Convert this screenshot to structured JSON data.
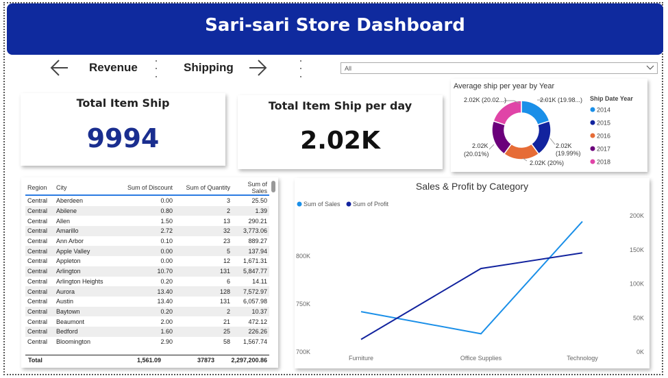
{
  "header": {
    "title": "Sari-sari Store Dashboard"
  },
  "nav": {
    "revenue_label": "Revenue",
    "shipping_label": "Shipping",
    "back_icon": "arrow-left-icon",
    "forward_icon": "arrow-right-icon"
  },
  "filter": {
    "value": "All"
  },
  "kpi_total": {
    "title": "Total Item Ship",
    "value": "9994",
    "color": "#1a2e8f"
  },
  "kpi_per_day": {
    "title": "Total Item Ship per day",
    "value": "2.02K"
  },
  "donut": {
    "title": "Average ship per year by Year",
    "legend_title": "Ship Date Year",
    "labels": [
      "2.01K (19.98...)",
      "2.02K",
      "(19.99%)",
      "2.02K (20%)",
      "2.02K",
      "(20.01%)",
      "2.02K (20.02...)"
    ],
    "chart_data": {
      "type": "pie",
      "categories": [
        "2014",
        "2015",
        "2016",
        "2017",
        "2018"
      ],
      "values": [
        19.98,
        19.99,
        20.0,
        20.01,
        20.02
      ],
      "colors": [
        "#1a8fe8",
        "#12239e",
        "#e66c37",
        "#6b007b",
        "#e044a7"
      ]
    }
  },
  "table": {
    "headers": [
      "Region",
      "City",
      "Sum of Discount",
      "Sum of Quantity",
      "Sum of Sales"
    ],
    "rows": [
      [
        "Central",
        "Aberdeen",
        "0.00",
        "3",
        "25.50"
      ],
      [
        "Central",
        "Abilene",
        "0.80",
        "2",
        "1.39"
      ],
      [
        "Central",
        "Allen",
        "1.50",
        "13",
        "290.21"
      ],
      [
        "Central",
        "Amarillo",
        "2.72",
        "32",
        "3,773.06"
      ],
      [
        "Central",
        "Ann Arbor",
        "0.10",
        "23",
        "889.27"
      ],
      [
        "Central",
        "Apple Valley",
        "0.00",
        "5",
        "137.94"
      ],
      [
        "Central",
        "Appleton",
        "0.00",
        "12",
        "1,671.31"
      ],
      [
        "Central",
        "Arlington",
        "10.70",
        "131",
        "5,847.77"
      ],
      [
        "Central",
        "Arlington Heights",
        "0.20",
        "6",
        "14.11"
      ],
      [
        "Central",
        "Aurora",
        "13.40",
        "128",
        "7,572.97"
      ],
      [
        "Central",
        "Austin",
        "13.40",
        "131",
        "6,057.98"
      ],
      [
        "Central",
        "Baytown",
        "0.20",
        "2",
        "10.37"
      ],
      [
        "Central",
        "Beaumont",
        "2.00",
        "21",
        "472.12"
      ],
      [
        "Central",
        "Bedford",
        "1.60",
        "25",
        "226.26"
      ],
      [
        "Central",
        "Bloomington",
        "2.90",
        "58",
        "1,567.74"
      ]
    ],
    "total": {
      "label": "Total",
      "discount": "1,561.09",
      "quantity": "37873",
      "sales": "2,297,200.86"
    }
  },
  "line_chart": {
    "title": "Sales & Profit by Category",
    "legend": [
      "Sum of Sales",
      "Sum of Profit"
    ],
    "y_left_ticks": [
      "800K",
      "750K",
      "700K"
    ],
    "y_right_ticks": [
      "200K",
      "150K",
      "100K",
      "50K",
      "0K"
    ],
    "chart_data": {
      "type": "line",
      "categories": [
        "Furniture",
        "Office Supplies",
        "Technology"
      ],
      "series": [
        {
          "name": "Sum of Sales",
          "axis": "left",
          "values": [
            742000,
            719000,
            836000
          ],
          "color": "#1a8fe8"
        },
        {
          "name": "Sum of Profit",
          "axis": "right",
          "values": [
            18450,
            122491,
            145455
          ],
          "color": "#12239e"
        }
      ],
      "ylim_left": [
        700000,
        842000
      ],
      "ylim_right": [
        0,
        200000
      ]
    }
  }
}
